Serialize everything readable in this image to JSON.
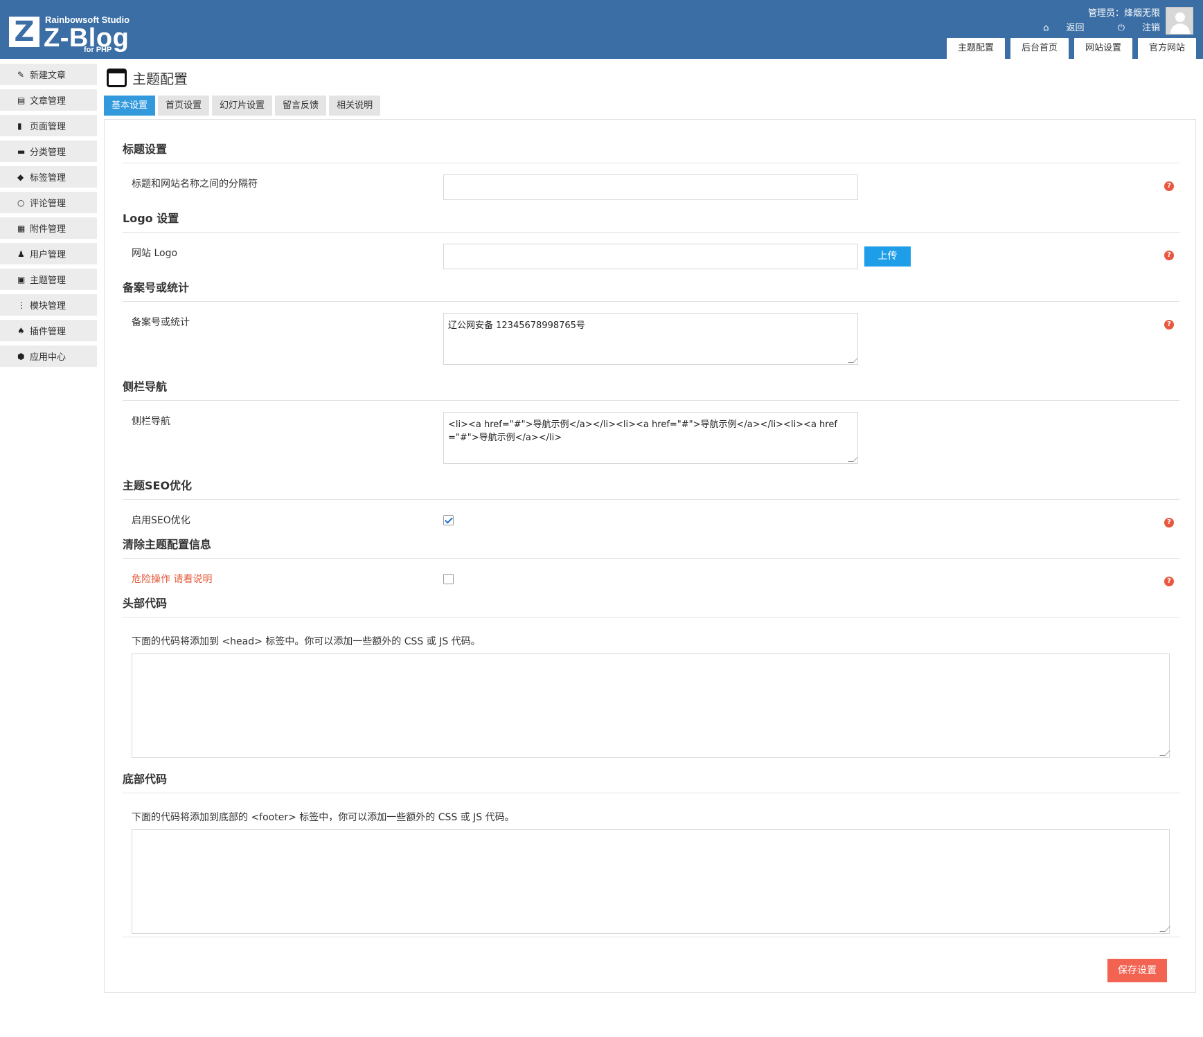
{
  "header": {
    "logo": {
      "letter": "Z",
      "studio": "Rainbowsoft Studio",
      "brand": "Z-Blog",
      "sub": "for PHP"
    },
    "user_label": "管理员：烽烟无限",
    "back_label": "返回",
    "logout_label": "注销",
    "top_nav": [
      "主题配置",
      "后台首页",
      "网站设置",
      "官方网站"
    ]
  },
  "left_menu": [
    {
      "label": "新建文章",
      "icon": "pencil-icon"
    },
    {
      "label": "文章管理",
      "icon": "document-icon"
    },
    {
      "label": "页面管理",
      "icon": "file-icon"
    },
    {
      "label": "分类管理",
      "icon": "folder-icon"
    },
    {
      "label": "标签管理",
      "icon": "tag-icon"
    },
    {
      "label": "评论管理",
      "icon": "comment-icon"
    },
    {
      "label": "附件管理",
      "icon": "archive-icon"
    },
    {
      "label": "用户管理",
      "icon": "user-icon"
    },
    {
      "label": "主题管理",
      "icon": "layout-icon"
    },
    {
      "label": "模块管理",
      "icon": "module-icon"
    },
    {
      "label": "插件管理",
      "icon": "plugin-icon"
    },
    {
      "label": "应用中心",
      "icon": "cube-icon"
    }
  ],
  "page": {
    "title": "主题配置",
    "tabs": [
      "基本设置",
      "首页设置",
      "幻灯片设置",
      "留言反馈",
      "相关说明"
    ],
    "active_tab": 0
  },
  "sections": {
    "title_settings": {
      "heading": "标题设置",
      "label": "标题和网站名称之间的分隔符",
      "value": ""
    },
    "logo_settings": {
      "heading": "Logo 设置",
      "label": "网站 Logo",
      "value": "",
      "upload_label": "上传"
    },
    "beian": {
      "heading": "备案号或统计",
      "label": "备案号或统计",
      "value": "辽公网安备 12345678998765号"
    },
    "sidebar_nav": {
      "heading": "侧栏导航",
      "label": "侧栏导航",
      "value": "<li><a href=\"#\">导航示例</a></li><li><a href=\"#\">导航示例</a></li><li><a href=\"#\">导航示例</a></li>"
    },
    "seo": {
      "heading": "主题SEO优化",
      "label": "启用SEO优化",
      "checked": true
    },
    "clear_config": {
      "heading": "清除主题配置信息",
      "label": "危险操作 请看说明",
      "checked": false
    },
    "head_code": {
      "heading": "头部代码",
      "desc": "下面的代码将添加到 <head> 标签中。你可以添加一些额外的 CSS 或 JS 代码。",
      "value": ""
    },
    "footer_code": {
      "heading": "底部代码",
      "desc": "下面的代码将添加到底部的 <footer> 标签中，你可以添加一些额外的 CSS 或 JS 代码。",
      "value": ""
    }
  },
  "save_label": "保存设置",
  "colors": {
    "header": "#3a6ea5",
    "tab_active": "#3399dd",
    "upload": "#1e9ee8",
    "save": "#f26352",
    "help": "#e9573f",
    "danger_text": "#e55a3b"
  }
}
